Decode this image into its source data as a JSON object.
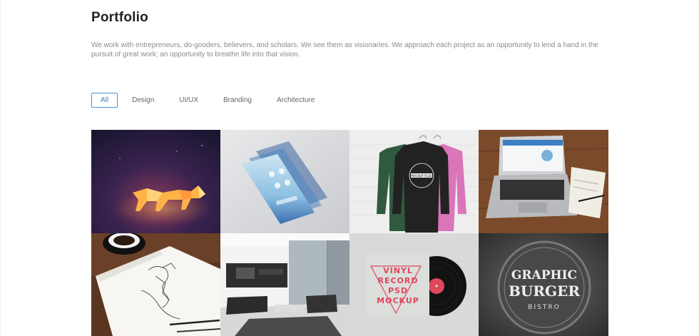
{
  "page": {
    "title": "Portfolio",
    "description": "We work with entrepreneurs, do-gooders, believers, and scholars. We see them as visionaries. We approach each project as an opportunity to lend a hand in the pursuit of great work; an opportunity to breathe life into that vision."
  },
  "filters": {
    "active": "All",
    "items": [
      {
        "label": "All"
      },
      {
        "label": "Design"
      },
      {
        "label": "UI/UX"
      },
      {
        "label": "Branding"
      },
      {
        "label": "Architecture"
      }
    ]
  },
  "portfolio": {
    "items": [
      {
        "subject": "glowing-polygon-animal"
      },
      {
        "subject": "phone-ui-mockup"
      },
      {
        "subject": "sweatshirts-on-hangers",
        "text": [
          "MOCKUP FILES"
        ]
      },
      {
        "subject": "laptop-on-desk"
      },
      {
        "subject": "sketchbook-coffee"
      },
      {
        "subject": "modern-interior"
      },
      {
        "subject": "vinyl-record-mockup",
        "text": [
          "VINYL",
          "RECORD",
          "PSD",
          "MOCKUP"
        ]
      },
      {
        "subject": "graphic-burger-sign",
        "text": [
          "GRAPHIC",
          "BURGER",
          "BISTRO"
        ]
      }
    ]
  },
  "colors": {
    "accent": "#4a90d9",
    "title": "#222222",
    "body_text": "#8a8a8a",
    "vinyl_label": "#e0475c"
  }
}
